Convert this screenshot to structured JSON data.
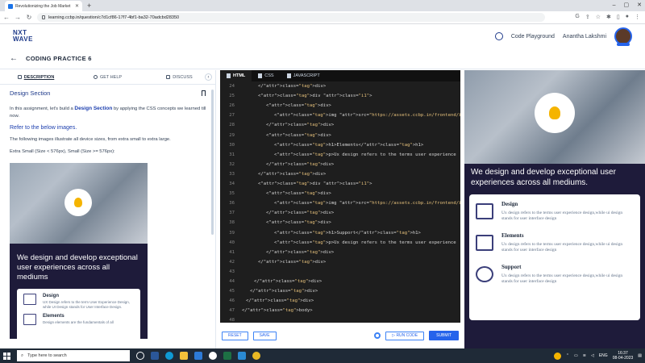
{
  "browser": {
    "tab_title": "Revolutionizing the Job Market",
    "url": "learning.ccbp.in/question/c7d1cf86-17f7-4bf1-ba32-70adcbd28350"
  },
  "header": {
    "logo_top": "NXT",
    "logo_bottom": "WAVE",
    "code_playground": "Code Playground",
    "user_name": "Anantha Lakshmi"
  },
  "practice": {
    "title": "CODING PRACTICE 6"
  },
  "left_panel": {
    "tabs": [
      {
        "label": "DESCRIPTION"
      },
      {
        "label": "GET HELP"
      },
      {
        "label": "DISCUSS"
      }
    ],
    "heading": "Design Section",
    "intro_prefix": "In this assignment, let's build a ",
    "intro_bold": "Design Section",
    "intro_suffix": " by applying the CSS concepts we learned till now.",
    "refer": "Refer to the below images.",
    "devices": "The following images illustrate all device sizes, from extra small to extra large.",
    "sizes": "Extra Small (Size < 576px), Small (Size >= 576px):",
    "preview": {
      "tagline": "We design and develop exceptional user experiences across all mediums",
      "items": [
        {
          "title": "Design",
          "desc": "UX Design refers to the term User Experience Design, while UI Design stands for User Interface Design."
        },
        {
          "title": "Elements",
          "desc": "Design elements are the fundamentals of all"
        }
      ]
    }
  },
  "editor": {
    "tabs": [
      {
        "label": "HTML"
      },
      {
        "label": "CSS"
      },
      {
        "label": "JAVASCRIPT"
      }
    ],
    "lines": [
      {
        "n": "24",
        "i": 4,
        "t": "</div>"
      },
      {
        "n": "25",
        "i": 4,
        "t": "<div class=\"i1\">"
      },
      {
        "n": "26",
        "i": 6,
        "t": "<div>"
      },
      {
        "n": "27",
        "i": 8,
        "t": "<img src=\"https://assets.ccbp.in/frontend/interme"
      },
      {
        "n": "28",
        "i": 6,
        "t": "</div>"
      },
      {
        "n": "29",
        "i": 6,
        "t": "<div>"
      },
      {
        "n": "30",
        "i": 8,
        "t": "<h1>Elements</h1>"
      },
      {
        "n": "31",
        "i": 8,
        "t": "<p>Ux design refers to the terms user experience"
      },
      {
        "n": "32",
        "i": 6,
        "t": "</div>"
      },
      {
        "n": "33",
        "i": 4,
        "t": "</div>"
      },
      {
        "n": "34",
        "i": 4,
        "t": "<div class=\"i1\">"
      },
      {
        "n": "35",
        "i": 6,
        "t": "<div>"
      },
      {
        "n": "36",
        "i": 8,
        "t": "<img src=\"https://assets.ccbp.in/frontend/interme"
      },
      {
        "n": "37",
        "i": 6,
        "t": "</div>"
      },
      {
        "n": "38",
        "i": 6,
        "t": "<div>"
      },
      {
        "n": "39",
        "i": 8,
        "t": "<h1>Support</h1>"
      },
      {
        "n": "40",
        "i": 8,
        "t": "<p>Ux design refers to the terms user experience"
      },
      {
        "n": "41",
        "i": 6,
        "t": "</div>"
      },
      {
        "n": "42",
        "i": 4,
        "t": "</div>"
      },
      {
        "n": "43",
        "i": 0,
        "t": ""
      },
      {
        "n": "44",
        "i": 3,
        "t": "</div>"
      },
      {
        "n": "45",
        "i": 2,
        "t": "</div>"
      },
      {
        "n": "46",
        "i": 1,
        "t": "</div>"
      },
      {
        "n": "47",
        "i": 0,
        "t": "</body>"
      },
      {
        "n": "48",
        "i": 0,
        "t": ""
      },
      {
        "n": "49",
        "i": 0,
        "t": "</html>"
      }
    ],
    "reset": "RESET",
    "save": "SAVE",
    "run": "RUN CODE",
    "submit": "SUBMIT"
  },
  "output": {
    "tagline": "We design and develop exceptional user experiences across all mediums.",
    "items": [
      {
        "title": "Design",
        "desc": "Ux design refers to the terms user experience design,while ui design stands for user interface design"
      },
      {
        "title": "Elements",
        "desc": "Ux design refers to the terms user experience design,while ui design stands for user interface design"
      },
      {
        "title": "Support",
        "desc": "Ux design refers to the terms user experience design,while ui design stands for user interface design"
      }
    ]
  },
  "taskbar": {
    "search_placeholder": "Type here to search",
    "lang": "ENG",
    "time": "16:37",
    "date": "08-04-2023"
  }
}
